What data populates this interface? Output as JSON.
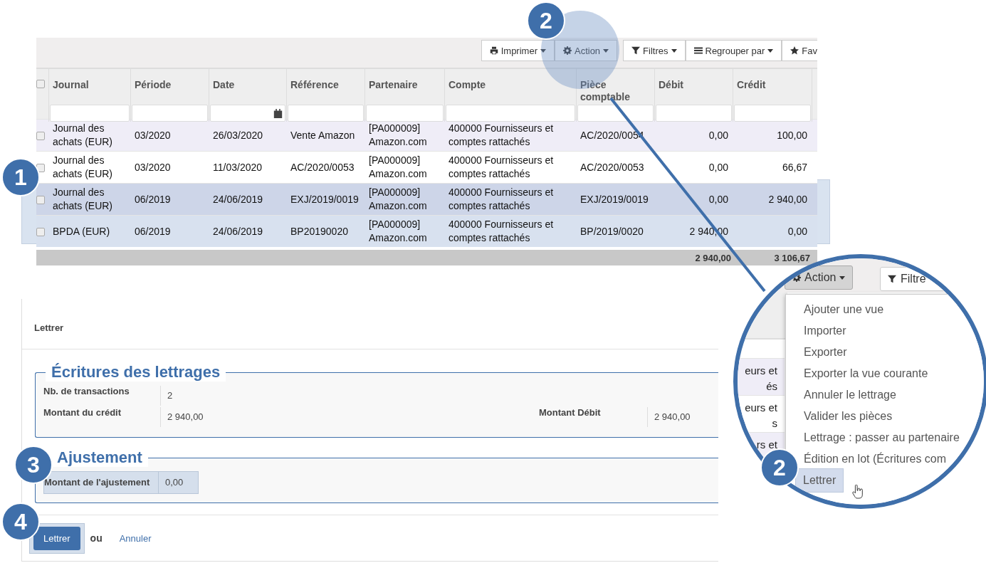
{
  "list_view": {
    "toolbar": {
      "buttons": [
        {
          "label": "Imprimer",
          "kind": "print"
        },
        {
          "label": "Action",
          "kind": "gear"
        }
      ],
      "search_options": [
        {
          "label": "Filtres",
          "kind": "filter"
        },
        {
          "label": "Regrouper par",
          "kind": "group"
        },
        {
          "label": "Fav",
          "kind": "star"
        }
      ]
    },
    "select_all_checked": false,
    "columns": [
      {
        "label": "Journal",
        "date_picker": false
      },
      {
        "label": "Période",
        "date_picker": false
      },
      {
        "label": "Date",
        "date_picker": true
      },
      {
        "label": "Référence",
        "date_picker": false
      },
      {
        "label": "Partenaire",
        "date_picker": false
      },
      {
        "label": "Compte",
        "date_picker": false
      },
      {
        "label": "Pièce comptable",
        "date_picker": false
      },
      {
        "label": "Débit",
        "date_picker": false
      },
      {
        "label": "Crédit",
        "date_picker": false
      }
    ],
    "rows": [
      {
        "selected": false,
        "checked": false,
        "cells": [
          "Journal des achats (EUR)",
          "03/2020",
          "26/03/2020",
          "Vente Amazon",
          "[PA000009] Amazon.com",
          "400000 Fournisseurs et comptes rattachés",
          "AC/2020/0054",
          "0,00",
          "100,00"
        ]
      },
      {
        "selected": false,
        "checked": false,
        "cells": [
          "Journal des achats (EUR)",
          "03/2020",
          "11/03/2020",
          "AC/2020/0053",
          "[PA000009] Amazon.com",
          "400000 Fournisseurs et comptes rattachés",
          "AC/2020/0053",
          "0,00",
          "66,67"
        ]
      },
      {
        "selected": true,
        "checked": false,
        "cells": [
          "Journal des achats (EUR)",
          "06/2019",
          "24/06/2019",
          "EXJ/2019/0019",
          "[PA000009] Amazon.com",
          "400000 Fournisseurs et comptes rattachés",
          "EXJ/2019/0019",
          "0,00",
          "2 940,00"
        ]
      },
      {
        "selected": true,
        "checked": false,
        "cells": [
          "BPDA (EUR)",
          "06/2019",
          "24/06/2019",
          "BP20190020",
          "[PA000009] Amazon.com",
          "400000 Fournisseurs et comptes rattachés",
          "BP/2019/0020",
          "2 940,00",
          "0,00"
        ]
      }
    ],
    "totals": {
      "debit": "2 940,00",
      "credit": "3 106,67"
    }
  },
  "zoom_inset": {
    "action_button": {
      "label": "Action",
      "pressed": true
    },
    "filter_button": "Filtre",
    "row_fragments": [
      {
        "lines": [
          "eurs et",
          "és"
        ]
      },
      {
        "lines": [
          "eurs et",
          "s"
        ]
      },
      {
        "lines": [
          "rs et"
        ]
      }
    ],
    "menu": [
      {
        "label": "Ajouter une vue",
        "selected": false
      },
      {
        "label": "Importer",
        "selected": false
      },
      {
        "label": "Exporter",
        "selected": false
      },
      {
        "label": "Exporter la vue courante",
        "selected": false
      },
      {
        "label": "Annuler le lettrage",
        "selected": false
      },
      {
        "label": "Valider les pièces",
        "selected": false
      },
      {
        "label": "Lettrage : passer au partenaire",
        "selected": false
      },
      {
        "label": "Édition en lot (Écritures com",
        "selected": false
      },
      {
        "label": "Lettrer",
        "selected": true
      }
    ]
  },
  "form": {
    "title": "Lettrer",
    "sections": [
      {
        "legend": "Écritures des lettrages",
        "fields": [
          {
            "label": "Nb. de transactions",
            "value": "2"
          },
          {
            "label": "Montant du crédit",
            "value": "2 940,00"
          },
          {
            "label": "Montant Débit",
            "value": "2 940,00"
          }
        ]
      },
      {
        "legend": "Ajustement",
        "fields": [
          {
            "label": "Montant de l'ajustement",
            "value": "0,00"
          }
        ]
      }
    ],
    "footer": {
      "button": "Lettrer",
      "separator": "ou",
      "link": "Annuler"
    }
  },
  "callouts": [
    {
      "number": "1"
    },
    {
      "number": "2"
    },
    {
      "number": "2"
    },
    {
      "number": "3"
    },
    {
      "number": "4"
    }
  ]
}
